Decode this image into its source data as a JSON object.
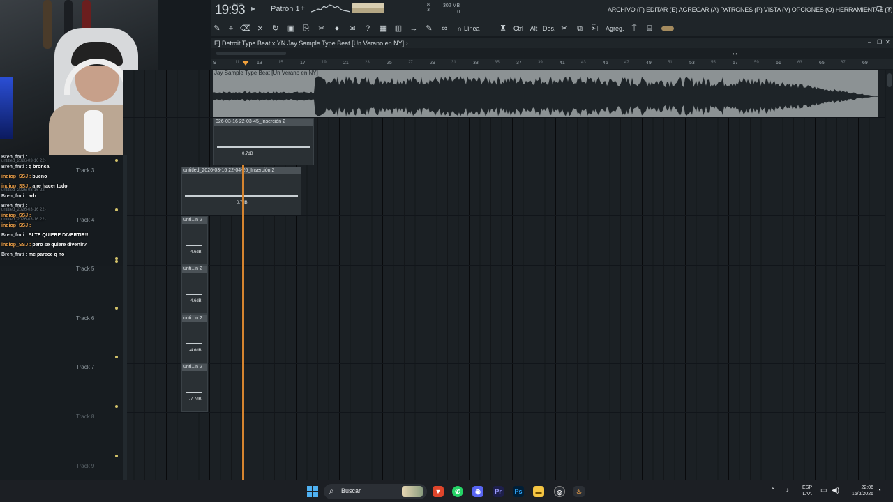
{
  "webcam": {},
  "chat": {
    "lines": [
      {
        "user": "Bren_fmti :",
        "text": "",
        "ghost": "untitled_2026-03-16 22-"
      },
      {
        "user": "Bren_fmti :",
        "text": "q bronca",
        "ghost": ""
      },
      {
        "user": "indiop_SSJ :",
        "text": "bueno",
        "ghost": ""
      },
      {
        "user": "indiop_SSJ :",
        "text": "a re hacer todo",
        "ghost": "untitled_2026-03-16 22-"
      },
      {
        "user": "Bren_fmti :",
        "text": "arh",
        "ghost": ""
      },
      {
        "user": "Bren_fmti :",
        "text": "",
        "ghost": "untitled_2026-03-16 22-"
      },
      {
        "user": "indiop_SSJ :",
        "text": "",
        "ghost": "untitled_2026-03-16 22-"
      },
      {
        "user": "indiop_SSJ :",
        "text": "",
        "ghost": ""
      },
      {
        "user": "Bren_fmti :",
        "text": "SI TE QUIERE DIVERTIR!!",
        "ghost": ""
      },
      {
        "user": "indiop_SSJ :",
        "text": "pero se quiere divertir?",
        "ghost": ""
      },
      {
        "user": "Bren_fmti :",
        "text": "me parece q no",
        "ghost": ""
      }
    ]
  },
  "menubar": {
    "time": "19:93",
    "time_sub": "M:S:CS",
    "pattern": "Patrón 1",
    "mem_top": "8",
    "mem_bottom": "3",
    "cpu_top": "302 MB",
    "cpu_bottom": "0",
    "menu": "ARCHIVO (F) EDITAR (E) AGREGAR (A) PATRONES (P) VISTA (V) OPCIONES (O) HERRAMIENTAS (T) AYUDA"
  },
  "toolbar": {
    "line_mode": "Línea",
    "ctrl": "Ctrl",
    "alt": "Alt",
    "des": "Des.",
    "agreg": "Agreg."
  },
  "playlist": {
    "title": "E] Detroit Type Beat x YN Jay Sample Type Beat [Un Verano en NY] ›",
    "ruler": [
      "9",
      "11",
      "13",
      "15",
      "17",
      "19",
      "21",
      "23",
      "25",
      "27",
      "29",
      "31",
      "33",
      "35",
      "37",
      "39",
      "41",
      "43",
      "45",
      "47",
      "49",
      "51",
      "53",
      "55",
      "57",
      "59",
      "61",
      "63",
      "65",
      "67",
      "69"
    ],
    "master_clip_name": "Jay Sample Type Beat [Un Verano en NY]",
    "tracks": [
      {
        "label": "Track 3"
      },
      {
        "label": "Track 4"
      },
      {
        "label": "Track 5"
      },
      {
        "label": "Track 6"
      },
      {
        "label": "Track 7"
      },
      {
        "label": "Track 8"
      },
      {
        "label": "Track 9"
      }
    ],
    "clips": [
      {
        "name": "026-03-16 22-03-45_Inserción 2",
        "vol": "0.7dB"
      },
      {
        "name": "untitled_2026-03-16 22-04-26_Inserción 2",
        "vol": "0.7dB"
      },
      {
        "name": "unti...n 2",
        "vol": "-4.6dB"
      },
      {
        "name": "unti...n 2",
        "vol": "-4.6dB"
      },
      {
        "name": "unti...n 2",
        "vol": "-4.6dB"
      },
      {
        "name": "unti...n 2",
        "vol": "-7.7dB"
      }
    ]
  },
  "taskbar": {
    "search": "Buscar",
    "lang_top": "ESP",
    "lang_bottom": "LAA",
    "time": "22:06",
    "date": "16/3/2026"
  },
  "colors": {
    "accent": "#f0a24a",
    "bg": "#161b1f",
    "track_dot": "#d4c36a"
  }
}
